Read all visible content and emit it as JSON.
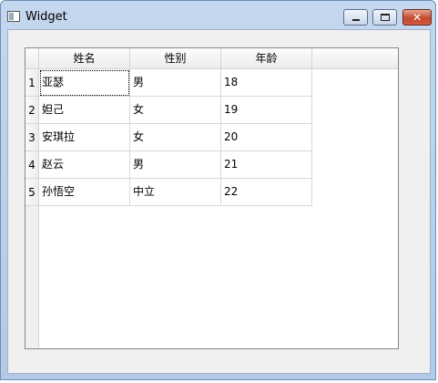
{
  "window": {
    "title": "Widget"
  },
  "title_controls": {
    "minimize_glyph": "—",
    "maximize_glyph": "□",
    "close_glyph": "✕"
  },
  "table": {
    "columns": [
      "姓名",
      "性别",
      "年龄"
    ],
    "row_numbers": [
      "1",
      "2",
      "3",
      "4",
      "5"
    ],
    "rows": [
      [
        "亚瑟",
        "男",
        "18"
      ],
      [
        "妲己",
        "女",
        "19"
      ],
      [
        "安琪拉",
        "女",
        "20"
      ],
      [
        "赵云",
        "男",
        "21"
      ],
      [
        "孙悟空",
        "中立",
        "22"
      ]
    ],
    "current_cell": [
      0,
      0
    ]
  },
  "colors": {
    "title_bar": "#b9cde8",
    "close_button": "#c44a2f",
    "client_background": "#f0f0f0",
    "grid_line": "#d8d8d8"
  }
}
